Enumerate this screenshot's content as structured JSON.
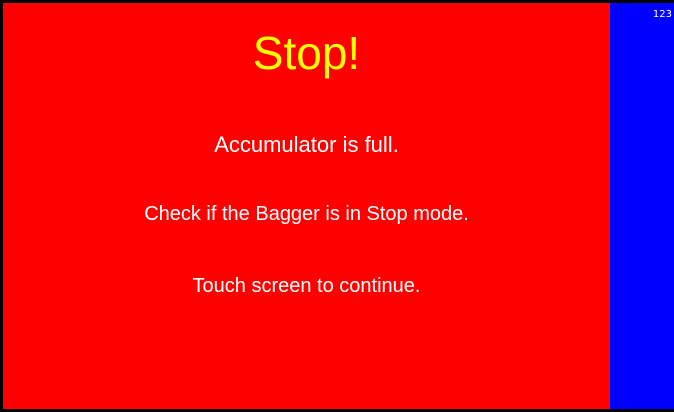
{
  "alert": {
    "title": "Stop!",
    "message": "Accumulator is full.",
    "instruction": "Check if the Bagger is in Stop mode.",
    "prompt": "Touch screen to continue."
  },
  "side_panel": {
    "indicator": "123"
  },
  "colors": {
    "alert_background": "#ff0000",
    "title_text": "#ffff00",
    "body_text": "#ffffff",
    "side_panel": "#0000ff",
    "frame": "#000000"
  }
}
